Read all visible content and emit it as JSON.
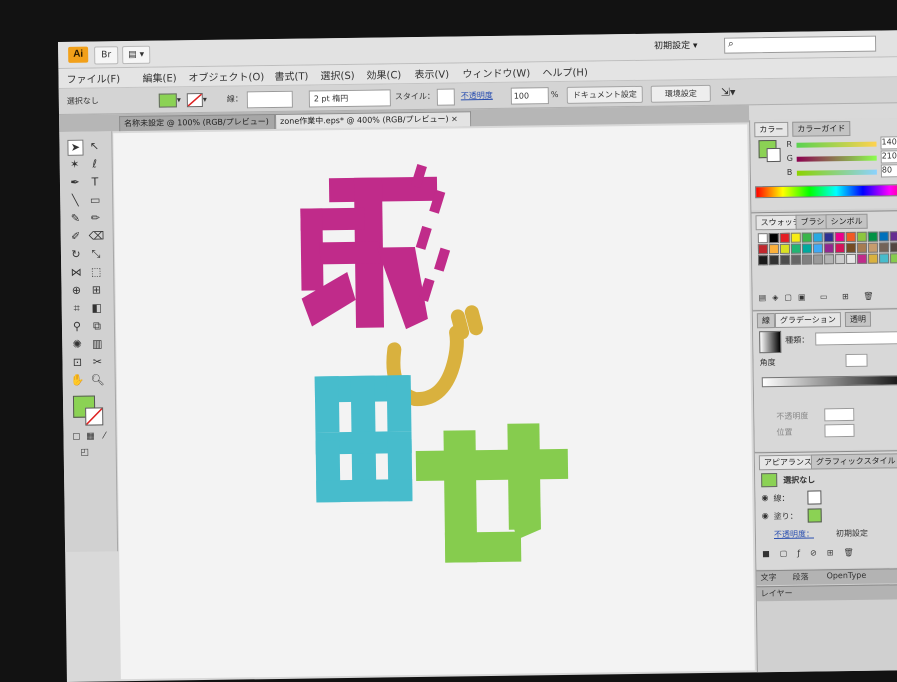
{
  "app": {
    "logo": "Ai",
    "bridge_label": "Br",
    "workspace": "初期設定",
    "search_placeholder": ""
  },
  "menu": [
    "ファイル(F)",
    "編集(E)",
    "オブジェクト(O)",
    "書式(T)",
    "選択(S)",
    "効果(C)",
    "表示(V)",
    "ウィンドウ(W)",
    "ヘルプ(H)"
  ],
  "control": {
    "selection_status": "選択なし",
    "stroke_label": "線：",
    "stroke_weight": "2 pt 楕円",
    "style_label": "スタイル：",
    "opacity_label": "不透明度",
    "opacity_value": "100",
    "percent": "%",
    "doc_setup_button": "ドキュメント設定",
    "prefs_button": "環境設定"
  },
  "tabs": [
    {
      "label": "名称未設定 @ 100% (RGB/プレビュー)",
      "close": "×"
    },
    {
      "label": "zone作業中.eps* @ 400% (RGB/プレビュー)",
      "close": "×"
    }
  ],
  "artwork": {
    "char1": "飛",
    "char2": "び",
    "char3": "出",
    "char4": "せ"
  },
  "colors": {
    "magenta": "#c02b8a",
    "yellow": "#d9b13e",
    "cyan": "#47bccc",
    "green": "#86cc4e",
    "fill_green": "#8bd254"
  },
  "color_panel": {
    "tabs": [
      "カラー",
      "カラーガイド"
    ],
    "r_value": "140",
    "g_value": "210",
    "b_value": "80"
  },
  "swatch_panel": {
    "tabs": [
      "スウォッチ",
      "ブラシ",
      "シンボル"
    ]
  },
  "gradient_panel": {
    "tabs": [
      "線",
      "グラデーション",
      "透明"
    ],
    "type_label": "種類：",
    "angle_label": "角度",
    "position_label": "位置"
  },
  "appearance_panel": {
    "tabs": [
      "アピアランス",
      "グラフィックスタイル"
    ],
    "title": "選択なし",
    "stroke_label": "線：",
    "fill_label": "塗り：",
    "opacity_label": "不透明度：",
    "opacity_value": "初期設定"
  },
  "bottom_tabs": [
    "文字",
    "段落",
    "OpenType"
  ],
  "layer_tab": "レイヤー"
}
